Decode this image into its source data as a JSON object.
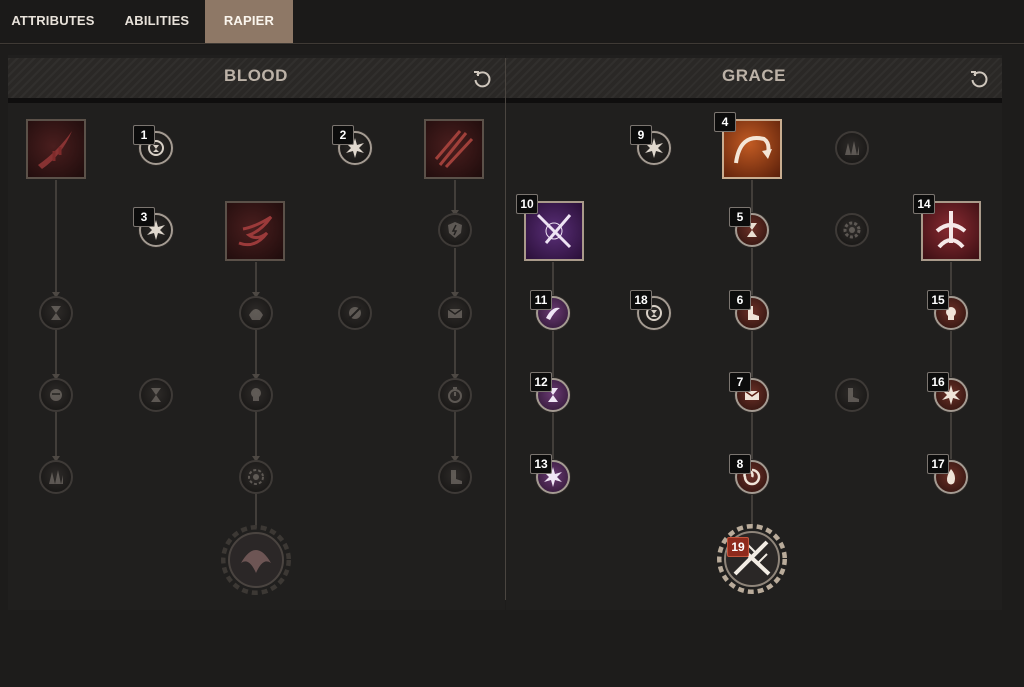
{
  "tabs": [
    {
      "label": "ATTRIBUTES",
      "active": false
    },
    {
      "label": "ABILITIES",
      "active": false
    },
    {
      "label": "RAPIER",
      "active": true
    }
  ],
  "trees": {
    "left": {
      "title": "BLOOD"
    },
    "right": {
      "title": "GRACE"
    }
  },
  "badges": {
    "b1": "1",
    "b2": "2",
    "b3": "3",
    "b4": "4",
    "b5": "5",
    "b6": "6",
    "b7": "7",
    "b8": "8",
    "b9": "9",
    "b10": "10",
    "b11": "11",
    "b12": "12",
    "b13": "13",
    "b14": "14",
    "b15": "15",
    "b16": "16",
    "b17": "17",
    "b18": "18",
    "b19": "19"
  },
  "colors": {
    "accent": "#8e7866",
    "capstone_badge": "#8e2a1c",
    "node_border_active": "#a49b92"
  }
}
